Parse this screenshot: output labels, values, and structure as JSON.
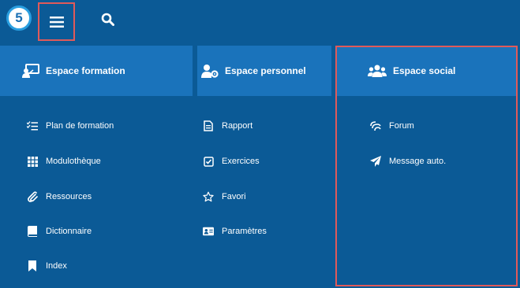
{
  "logo": {
    "text": "5"
  },
  "topbar": {
    "menu_icon": "hamburger-icon",
    "search_icon": "search-icon"
  },
  "columns": [
    {
      "header": "Espace formation",
      "icon": "presentation-icon",
      "items": [
        {
          "label": "Plan de formation",
          "icon": "checklist-icon"
        },
        {
          "label": "Modulothèque",
          "icon": "grid-icon"
        },
        {
          "label": "Ressources",
          "icon": "paperclip-icon"
        },
        {
          "label": "Dictionnaire",
          "icon": "book-icon"
        },
        {
          "label": "Index",
          "icon": "bookmark-icon"
        }
      ]
    },
    {
      "header": "Espace personnel",
      "icon": "user-gear-icon",
      "items": [
        {
          "label": "Rapport",
          "icon": "document-icon"
        },
        {
          "label": "Exercices",
          "icon": "checkbox-icon"
        },
        {
          "label": "Favori",
          "icon": "star-icon"
        },
        {
          "label": "Paramètres",
          "icon": "id-card-icon"
        }
      ]
    },
    {
      "header": "Espace social",
      "icon": "users-icon",
      "items": [
        {
          "label": "Forum",
          "icon": "forum-icon"
        },
        {
          "label": "Message auto.",
          "icon": "paper-plane-icon"
        }
      ]
    }
  ]
}
